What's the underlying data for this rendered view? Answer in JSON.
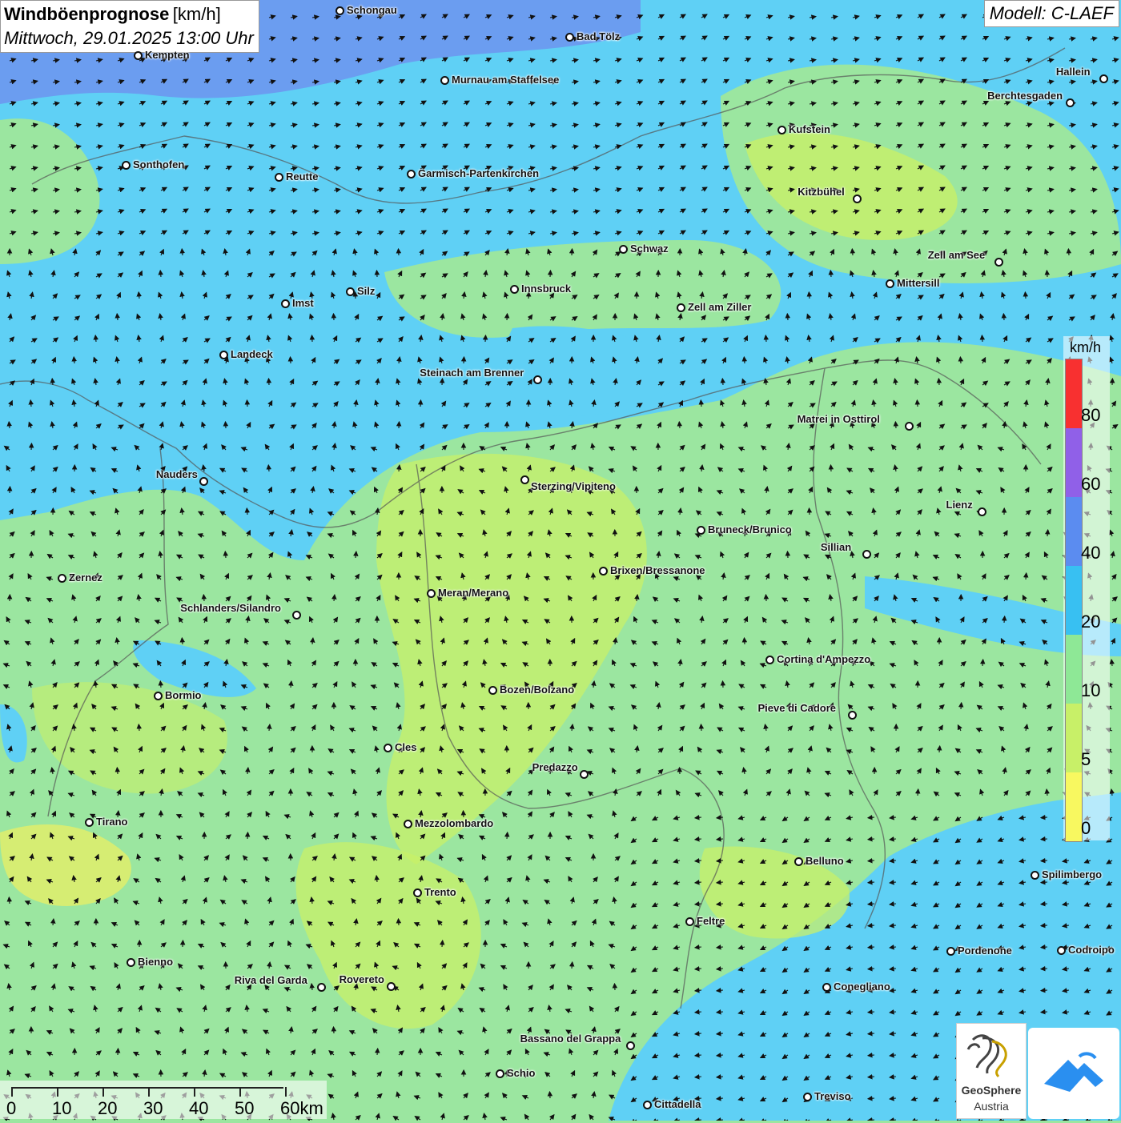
{
  "title": {
    "main": "Windböenprognose",
    "unit": "[km/h]",
    "date": "Mittwoch, 29.01.2025 13:00 Uhr"
  },
  "model": "Modell: C-LAEF",
  "legend": {
    "unit": "km/h",
    "labels": [
      "80",
      "60",
      "40",
      "20",
      "10",
      "5",
      "0"
    ],
    "colors": [
      "#f83030",
      "#9060e8",
      "#5b8cf0",
      "#38c0f2",
      "#8ee896",
      "#c8f068",
      "#f8f860"
    ]
  },
  "scale": {
    "labels": [
      "0",
      "10",
      "20",
      "30",
      "40",
      "50",
      "60km"
    ]
  },
  "branding": {
    "name": "GeoSphere",
    "sub": "Austria"
  },
  "cities": [
    {
      "name": "Schongau"
    },
    {
      "name": "Bad Tölz"
    },
    {
      "name": "Kempten"
    },
    {
      "name": "Murnau am Staffelsee"
    },
    {
      "name": "Hallein"
    },
    {
      "name": "Berchtesgaden"
    },
    {
      "name": "Kufstein"
    },
    {
      "name": "Sonthofen"
    },
    {
      "name": "Reutte"
    },
    {
      "name": "Garmisch-Partenkirchen"
    },
    {
      "name": "Kitzbühel"
    },
    {
      "name": "Schwaz"
    },
    {
      "name": "Zell am See"
    },
    {
      "name": "Mittersill"
    },
    {
      "name": "Innsbruck"
    },
    {
      "name": "Imst"
    },
    {
      "name": "Silz"
    },
    {
      "name": "Zell am Ziller"
    },
    {
      "name": "Landeck"
    },
    {
      "name": "Steinach am Brenner"
    },
    {
      "name": "Matrei in Osttirol"
    },
    {
      "name": "Nauders"
    },
    {
      "name": "Sterzing/Vipiteno"
    },
    {
      "name": "Lienz"
    },
    {
      "name": "Bruneck/Brunico"
    },
    {
      "name": "Sillian"
    },
    {
      "name": "Brixen/Bressanone"
    },
    {
      "name": "Zernez"
    },
    {
      "name": "Meran/Merano"
    },
    {
      "name": "Schlanders/Silandro"
    },
    {
      "name": "Cortina d'Ampezzo"
    },
    {
      "name": "Bozen/Bolzano"
    },
    {
      "name": "Bormio"
    },
    {
      "name": "Pieve di Cadore"
    },
    {
      "name": "Cles"
    },
    {
      "name": "Predazzo"
    },
    {
      "name": "Tirano"
    },
    {
      "name": "Mezzolombardo"
    },
    {
      "name": "Belluno"
    },
    {
      "name": "Spilimbergo"
    },
    {
      "name": "Trento"
    },
    {
      "name": "Feltre"
    },
    {
      "name": "Pordenone"
    },
    {
      "name": "Codroipo"
    },
    {
      "name": "Bienno"
    },
    {
      "name": "Riva del Garda"
    },
    {
      "name": "Rovereto"
    },
    {
      "name": "Conegliano"
    },
    {
      "name": "Bassano del Grappa"
    },
    {
      "name": "Schio"
    },
    {
      "name": "Treviso"
    },
    {
      "name": "Cittadella"
    }
  ]
}
